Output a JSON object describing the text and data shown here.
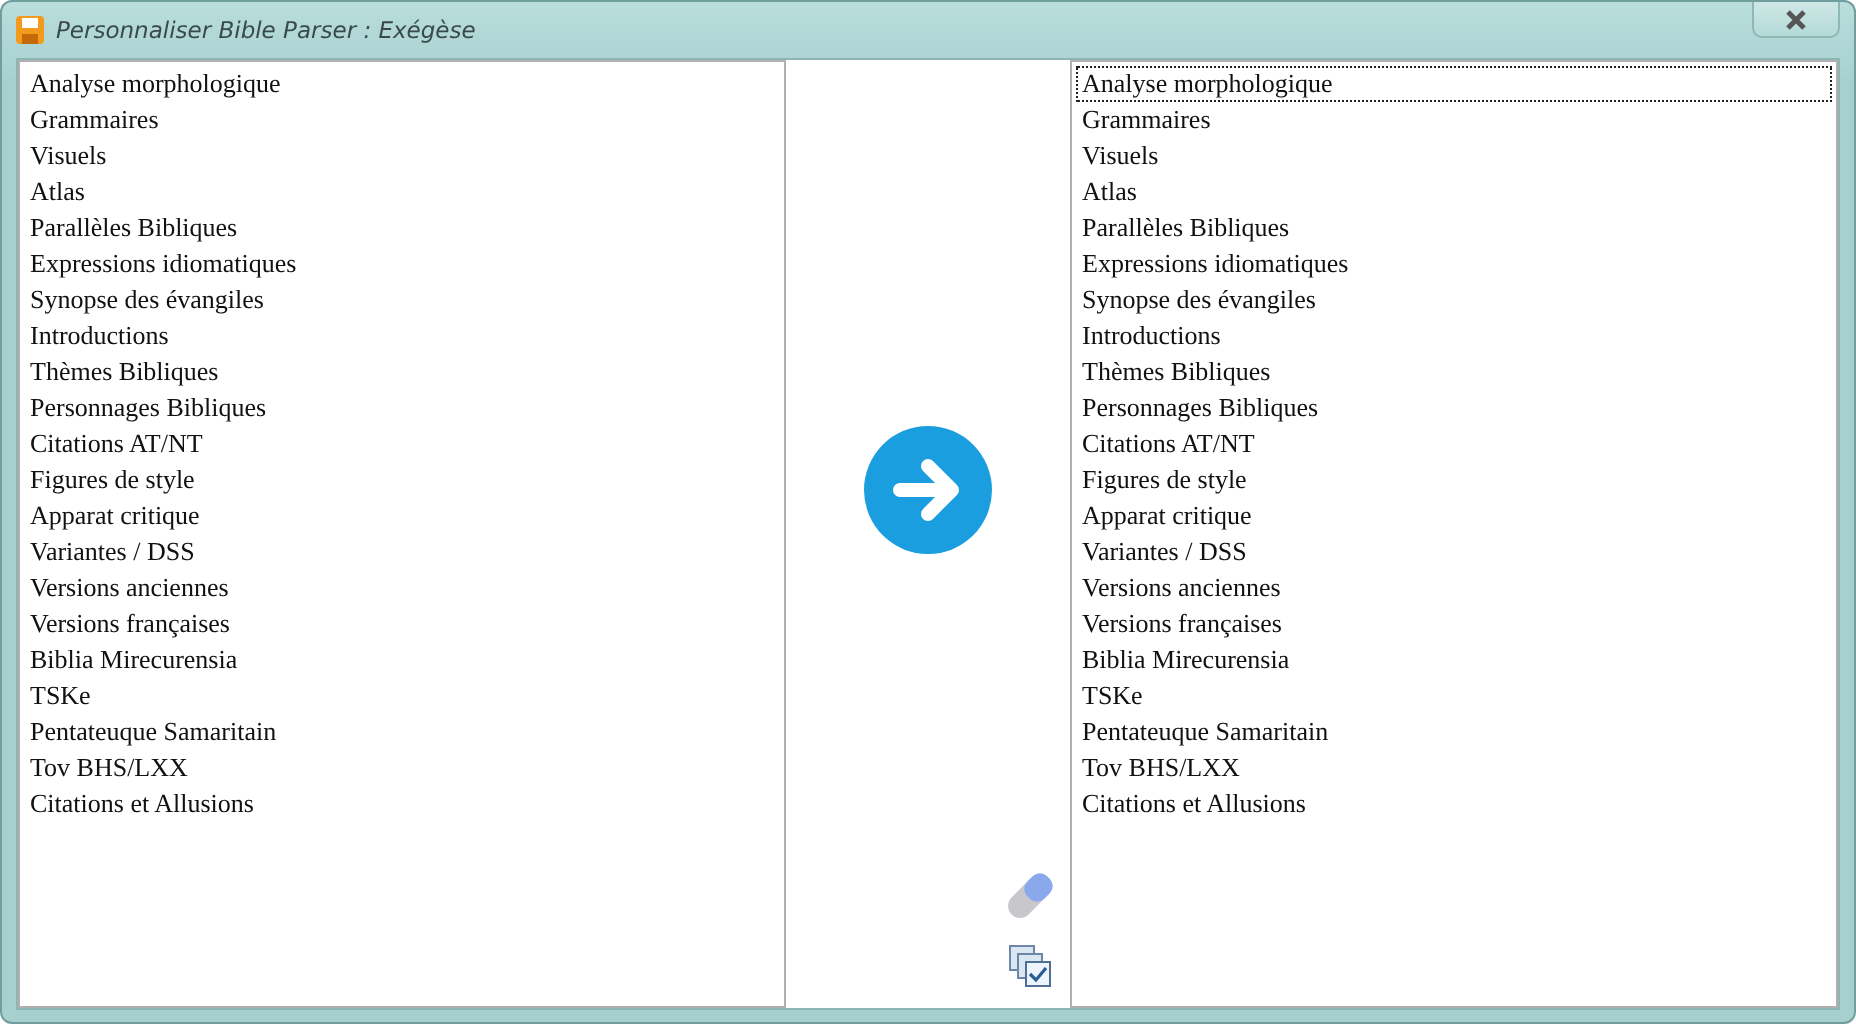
{
  "window": {
    "title": "Personnaliser Bible Parser : Exégèse"
  },
  "available": {
    "items": [
      {
        "label": "Analyse morphologique"
      },
      {
        "label": "Grammaires"
      },
      {
        "label": "Visuels"
      },
      {
        "label": "Atlas"
      },
      {
        "label": "Parallèles Bibliques"
      },
      {
        "label": "Expressions idiomatiques"
      },
      {
        "label": "Synopse des évangiles"
      },
      {
        "label": "Introductions"
      },
      {
        "label": "Thèmes Bibliques"
      },
      {
        "label": "Personnages Bibliques"
      },
      {
        "label": "Citations AT/NT"
      },
      {
        "label": "Figures de style"
      },
      {
        "label": "Apparat critique"
      },
      {
        "label": "Variantes / DSS"
      },
      {
        "label": "Versions anciennes"
      },
      {
        "label": "Versions françaises"
      },
      {
        "label": "Biblia Mirecurensia"
      },
      {
        "label": "TSKe"
      },
      {
        "label": "Pentateuque Samaritain"
      },
      {
        "label": "Tov BHS/LXX"
      },
      {
        "label": "Citations et Allusions"
      }
    ]
  },
  "chosen": {
    "items": [
      {
        "label": "Analyse morphologique",
        "focused": true
      },
      {
        "label": "Grammaires",
        "focused": false
      },
      {
        "label": "Visuels",
        "focused": false
      },
      {
        "label": "Atlas",
        "focused": false
      },
      {
        "label": "Parallèles Bibliques",
        "focused": false
      },
      {
        "label": "Expressions idiomatiques",
        "focused": false
      },
      {
        "label": "Synopse des évangiles",
        "focused": false
      },
      {
        "label": "Introductions",
        "focused": false
      },
      {
        "label": "Thèmes Bibliques",
        "focused": false
      },
      {
        "label": "Personnages Bibliques",
        "focused": false
      },
      {
        "label": "Citations AT/NT",
        "focused": false
      },
      {
        "label": "Figures de style",
        "focused": false
      },
      {
        "label": "Apparat critique",
        "focused": false
      },
      {
        "label": "Variantes / DSS",
        "focused": false
      },
      {
        "label": "Versions anciennes",
        "focused": false
      },
      {
        "label": "Versions françaises",
        "focused": false
      },
      {
        "label": "Biblia Mirecurensia",
        "focused": false
      },
      {
        "label": "TSKe",
        "focused": false
      },
      {
        "label": "Pentateuque Samaritain",
        "focused": false
      },
      {
        "label": "Tov BHS/LXX",
        "focused": false
      },
      {
        "label": "Citations et Allusions",
        "focused": false
      }
    ]
  }
}
